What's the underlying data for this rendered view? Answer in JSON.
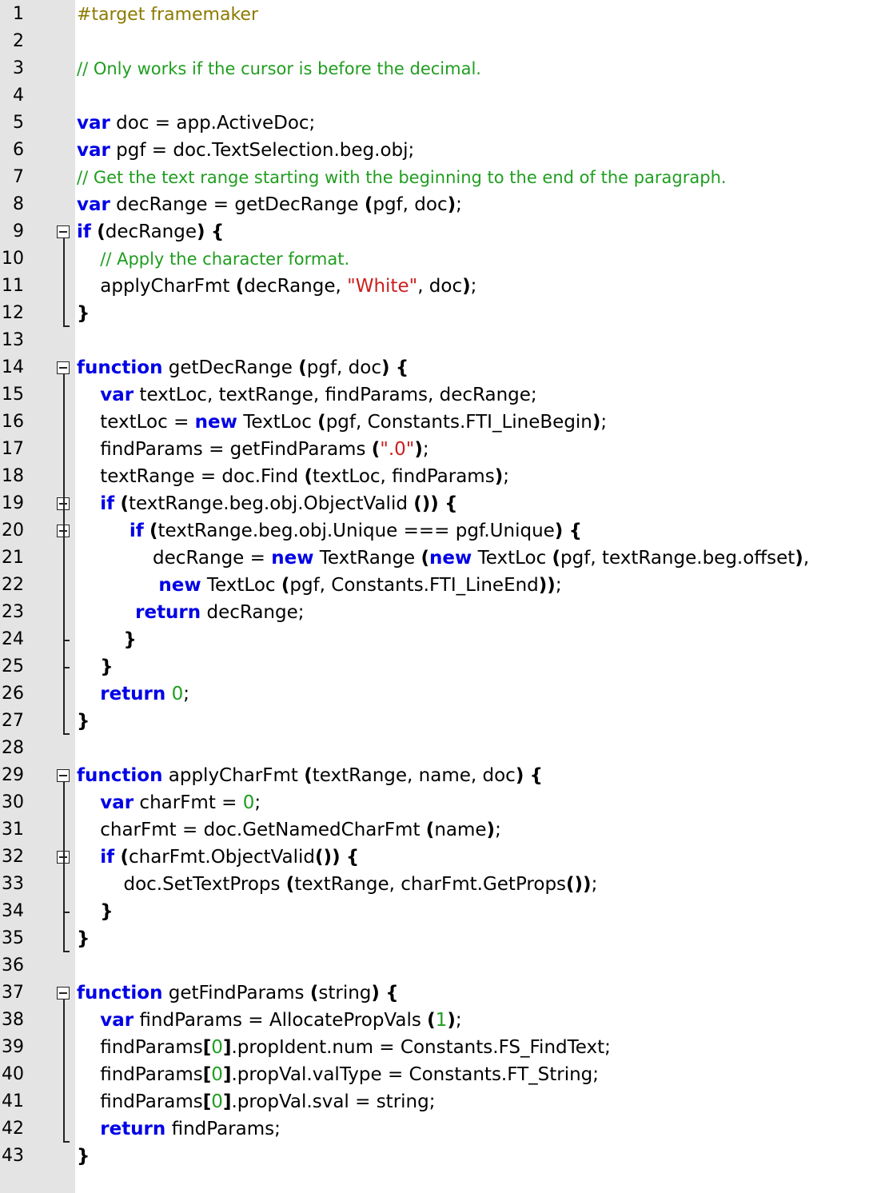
{
  "editor": {
    "fold_markers": [
      9,
      14,
      19,
      20,
      29,
      32,
      37
    ],
    "lines": [
      {
        "n": "1",
        "segs": [
          {
            "t": "#target framemaker",
            "c": "pp"
          }
        ]
      },
      {
        "n": "2",
        "segs": []
      },
      {
        "n": "3",
        "segs": [
          {
            "t": "// Only works if the cursor is before the decimal.",
            "c": "cm"
          }
        ]
      },
      {
        "n": "4",
        "segs": []
      },
      {
        "n": "5",
        "segs": [
          {
            "t": "var",
            "c": "kw"
          },
          {
            "t": " doc = app.ActiveDoc;"
          }
        ]
      },
      {
        "n": "6",
        "segs": [
          {
            "t": "var",
            "c": "kw"
          },
          {
            "t": " pgf = doc.TextSelection.beg.obj;"
          }
        ]
      },
      {
        "n": "7",
        "segs": [
          {
            "t": "// Get the text range starting with the beginning to the end of the paragraph.",
            "c": "cm"
          }
        ]
      },
      {
        "n": "8",
        "segs": [
          {
            "t": "var",
            "c": "kw"
          },
          {
            "t": " decRange = getDecRange "
          },
          {
            "t": "(",
            "c": "br"
          },
          {
            "t": "pgf, doc"
          },
          {
            "t": ")",
            "c": "br"
          },
          {
            "t": ";"
          }
        ]
      },
      {
        "n": "9",
        "segs": [
          {
            "t": "if",
            "c": "kw"
          },
          {
            "t": " "
          },
          {
            "t": "(",
            "c": "br"
          },
          {
            "t": "decRange"
          },
          {
            "t": ")",
            "c": "br"
          },
          {
            "t": " "
          },
          {
            "t": "{",
            "c": "br"
          }
        ]
      },
      {
        "n": "10",
        "segs": [
          {
            "t": "    "
          },
          {
            "t": "// Apply the character format.",
            "c": "cm"
          }
        ]
      },
      {
        "n": "11",
        "segs": [
          {
            "t": "    applyCharFmt "
          },
          {
            "t": "(",
            "c": "br"
          },
          {
            "t": "decRange, "
          },
          {
            "t": "\"White\"",
            "c": "st"
          },
          {
            "t": ", doc"
          },
          {
            "t": ")",
            "c": "br"
          },
          {
            "t": ";"
          }
        ]
      },
      {
        "n": "12",
        "segs": [
          {
            "t": "}",
            "c": "br"
          }
        ]
      },
      {
        "n": "13",
        "segs": []
      },
      {
        "n": "14",
        "segs": [
          {
            "t": "function",
            "c": "kw"
          },
          {
            "t": " getDecRange "
          },
          {
            "t": "(",
            "c": "br"
          },
          {
            "t": "pgf, doc"
          },
          {
            "t": ")",
            "c": "br"
          },
          {
            "t": " "
          },
          {
            "t": "{",
            "c": "br"
          }
        ]
      },
      {
        "n": "15",
        "segs": [
          {
            "t": "    "
          },
          {
            "t": "var",
            "c": "kw"
          },
          {
            "t": " textLoc, textRange, findParams, decRange;"
          }
        ]
      },
      {
        "n": "16",
        "segs": [
          {
            "t": "    textLoc = "
          },
          {
            "t": "new",
            "c": "kw"
          },
          {
            "t": " TextLoc "
          },
          {
            "t": "(",
            "c": "br"
          },
          {
            "t": "pgf, Constants.FTI_LineBegin"
          },
          {
            "t": ")",
            "c": "br"
          },
          {
            "t": ";"
          }
        ]
      },
      {
        "n": "17",
        "segs": [
          {
            "t": "    findParams = getFindParams "
          },
          {
            "t": "(",
            "c": "br"
          },
          {
            "t": "\".0\"",
            "c": "st"
          },
          {
            "t": ")",
            "c": "br"
          },
          {
            "t": ";"
          }
        ]
      },
      {
        "n": "18",
        "segs": [
          {
            "t": "    textRange = doc.Find "
          },
          {
            "t": "(",
            "c": "br"
          },
          {
            "t": "textLoc, findParams"
          },
          {
            "t": ")",
            "c": "br"
          },
          {
            "t": ";"
          }
        ]
      },
      {
        "n": "19",
        "segs": [
          {
            "t": "    "
          },
          {
            "t": "if",
            "c": "kw"
          },
          {
            "t": " "
          },
          {
            "t": "(",
            "c": "br"
          },
          {
            "t": "textRange.beg.obj.ObjectValid "
          },
          {
            "t": "())",
            "c": "br"
          },
          {
            "t": " "
          },
          {
            "t": "{",
            "c": "br"
          }
        ]
      },
      {
        "n": "20",
        "segs": [
          {
            "t": "         "
          },
          {
            "t": "if",
            "c": "kw"
          },
          {
            "t": " "
          },
          {
            "t": "(",
            "c": "br"
          },
          {
            "t": "textRange.beg.obj.Unique === pgf.Unique"
          },
          {
            "t": ")",
            "c": "br"
          },
          {
            "t": " "
          },
          {
            "t": "{",
            "c": "br"
          }
        ]
      },
      {
        "n": "21",
        "segs": [
          {
            "t": "             decRange = "
          },
          {
            "t": "new",
            "c": "kw"
          },
          {
            "t": " TextRange "
          },
          {
            "t": "(",
            "c": "br"
          },
          {
            "t": "new",
            "c": "kw"
          },
          {
            "t": " TextLoc "
          },
          {
            "t": "(",
            "c": "br"
          },
          {
            "t": "pgf, textRange.beg.offset"
          },
          {
            "t": ")",
            "c": "br"
          },
          {
            "t": ","
          }
        ]
      },
      {
        "n": "22",
        "segs": [
          {
            "t": "              "
          },
          {
            "t": "new",
            "c": "kw"
          },
          {
            "t": " TextLoc "
          },
          {
            "t": "(",
            "c": "br"
          },
          {
            "t": "pgf, Constants.FTI_LineEnd"
          },
          {
            "t": "))",
            "c": "br"
          },
          {
            "t": ";"
          }
        ]
      },
      {
        "n": "23",
        "segs": [
          {
            "t": "          "
          },
          {
            "t": "return",
            "c": "kw"
          },
          {
            "t": " decRange;"
          }
        ]
      },
      {
        "n": "24",
        "segs": [
          {
            "t": "        "
          },
          {
            "t": "}",
            "c": "br"
          }
        ]
      },
      {
        "n": "25",
        "segs": [
          {
            "t": "    "
          },
          {
            "t": "}",
            "c": "br"
          }
        ]
      },
      {
        "n": "26",
        "segs": [
          {
            "t": "    "
          },
          {
            "t": "return",
            "c": "kw"
          },
          {
            "t": " "
          },
          {
            "t": "0",
            "c": "nm"
          },
          {
            "t": ";"
          }
        ]
      },
      {
        "n": "27",
        "segs": [
          {
            "t": "}",
            "c": "br"
          }
        ]
      },
      {
        "n": "28",
        "segs": []
      },
      {
        "n": "29",
        "segs": [
          {
            "t": "function",
            "c": "kw"
          },
          {
            "t": " applyCharFmt "
          },
          {
            "t": "(",
            "c": "br"
          },
          {
            "t": "textRange, name, doc"
          },
          {
            "t": ")",
            "c": "br"
          },
          {
            "t": " "
          },
          {
            "t": "{",
            "c": "br"
          }
        ]
      },
      {
        "n": "30",
        "segs": [
          {
            "t": "    "
          },
          {
            "t": "var",
            "c": "kw"
          },
          {
            "t": " charFmt = "
          },
          {
            "t": "0",
            "c": "nm"
          },
          {
            "t": ";"
          }
        ]
      },
      {
        "n": "31",
        "segs": [
          {
            "t": "    charFmt = doc.GetNamedCharFmt "
          },
          {
            "t": "(",
            "c": "br"
          },
          {
            "t": "name"
          },
          {
            "t": ")",
            "c": "br"
          },
          {
            "t": ";"
          }
        ]
      },
      {
        "n": "32",
        "segs": [
          {
            "t": "    "
          },
          {
            "t": "if",
            "c": "kw"
          },
          {
            "t": " "
          },
          {
            "t": "(",
            "c": "br"
          },
          {
            "t": "charFmt.ObjectValid"
          },
          {
            "t": "())",
            "c": "br"
          },
          {
            "t": " "
          },
          {
            "t": "{",
            "c": "br"
          }
        ]
      },
      {
        "n": "33",
        "segs": [
          {
            "t": "        doc.SetTextProps "
          },
          {
            "t": "(",
            "c": "br"
          },
          {
            "t": "textRange, charFmt.GetProps"
          },
          {
            "t": "())",
            "c": "br"
          },
          {
            "t": ";"
          }
        ]
      },
      {
        "n": "34",
        "segs": [
          {
            "t": "    "
          },
          {
            "t": "}",
            "c": "br"
          }
        ]
      },
      {
        "n": "35",
        "segs": [
          {
            "t": "}",
            "c": "br"
          }
        ]
      },
      {
        "n": "36",
        "segs": []
      },
      {
        "n": "37",
        "segs": [
          {
            "t": "function",
            "c": "kw"
          },
          {
            "t": " getFindParams "
          },
          {
            "t": "(",
            "c": "br"
          },
          {
            "t": "string"
          },
          {
            "t": ")",
            "c": "br"
          },
          {
            "t": " "
          },
          {
            "t": "{",
            "c": "br"
          }
        ]
      },
      {
        "n": "38",
        "segs": [
          {
            "t": "    "
          },
          {
            "t": "var",
            "c": "kw"
          },
          {
            "t": " findParams = AllocatePropVals "
          },
          {
            "t": "(",
            "c": "br"
          },
          {
            "t": "1",
            "c": "nm"
          },
          {
            "t": ")",
            "c": "br"
          },
          {
            "t": ";"
          }
        ]
      },
      {
        "n": "39",
        "segs": [
          {
            "t": "    findParams"
          },
          {
            "t": "[",
            "c": "br"
          },
          {
            "t": "0",
            "c": "nm"
          },
          {
            "t": "]",
            "c": "br"
          },
          {
            "t": ".propIdent.num = Constants.FS_FindText;"
          }
        ]
      },
      {
        "n": "40",
        "segs": [
          {
            "t": "    findParams"
          },
          {
            "t": "[",
            "c": "br"
          },
          {
            "t": "0",
            "c": "nm"
          },
          {
            "t": "]",
            "c": "br"
          },
          {
            "t": ".propVal.valType = Constants.FT_String;"
          }
        ]
      },
      {
        "n": "41",
        "segs": [
          {
            "t": "    findParams"
          },
          {
            "t": "[",
            "c": "br"
          },
          {
            "t": "0",
            "c": "nm"
          },
          {
            "t": "]",
            "c": "br"
          },
          {
            "t": ".propVal.sval = string;"
          }
        ]
      },
      {
        "n": "42",
        "segs": [
          {
            "t": "    "
          },
          {
            "t": "return",
            "c": "kw"
          },
          {
            "t": " findParams;"
          }
        ]
      },
      {
        "n": "43",
        "segs": [
          {
            "t": "}",
            "c": "br"
          }
        ]
      }
    ]
  }
}
